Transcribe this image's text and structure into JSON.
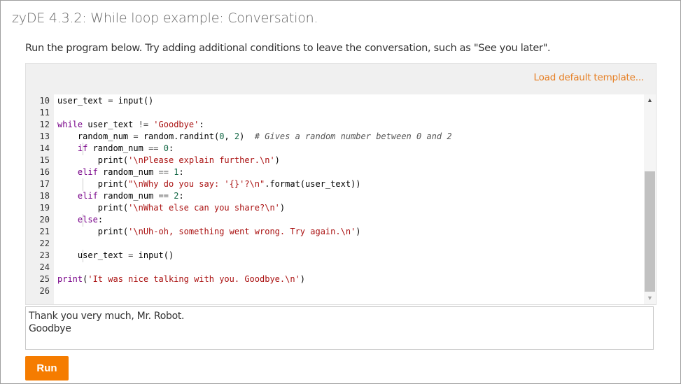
{
  "title": "zyDE 4.3.2: While loop example: Conversation.",
  "instructions": "Run the program below. Try adding additional conditions to leave the conversation, such as \"See you later\".",
  "editor": {
    "load_template_label": "Load default template...",
    "lines": [
      {
        "n": "10",
        "html": "user_text <span class='op'>=</span> input()"
      },
      {
        "n": "11",
        "html": ""
      },
      {
        "n": "12",
        "html": "<span class='kw'>while</span> user_text <span class='op'>!=</span> <span class='st'>'Goodbye'</span>:"
      },
      {
        "n": "13",
        "html": "    random_num <span class='op'>=</span> random.randint(<span class='nm'>0</span>, <span class='nm'>2</span>)  <span class='cm'># Gives a random number between 0 and 2</span>"
      },
      {
        "n": "14",
        "html": "    <span class='kw'>if</span> random_num <span class='op'>==</span> <span class='nm'>0</span>:"
      },
      {
        "n": "15",
        "html": "        print(<span class='st'>'\\nPlease explain further.\\n'</span>)"
      },
      {
        "n": "16",
        "html": "    <span class='kw'>elif</span> random_num <span class='op'>==</span> <span class='nm'>1</span>:"
      },
      {
        "n": "17",
        "html": "        print(<span class='st'>\"\\nWhy do you say: '{}'?\\n\"</span>.format(user_text))"
      },
      {
        "n": "18",
        "html": "    <span class='kw'>elif</span> random_num <span class='op'>==</span> <span class='nm'>2</span>:"
      },
      {
        "n": "19",
        "html": "        print(<span class='st'>'\\nWhat else can you share?\\n'</span>)"
      },
      {
        "n": "20",
        "html": "    <span class='kw'>else</span>:"
      },
      {
        "n": "21",
        "html": "        print(<span class='st'>'\\nUh-oh, something went wrong. Try again.\\n'</span>)"
      },
      {
        "n": "22",
        "html": ""
      },
      {
        "n": "23",
        "html": "    user_text <span class='op'>=</span> input()"
      },
      {
        "n": "24",
        "html": ""
      },
      {
        "n": "25",
        "html": "<span class='kw'>print</span>(<span class='st'>'It was nice talking with you. Goodbye.\\n'</span>)"
      },
      {
        "n": "26",
        "html": ""
      }
    ]
  },
  "input_box": {
    "value": "Thank you very much, Mr. Robot.\nGoodbye"
  },
  "run_button_label": "Run",
  "colors": {
    "accent": "#f57c00",
    "link": "#e67e22"
  }
}
